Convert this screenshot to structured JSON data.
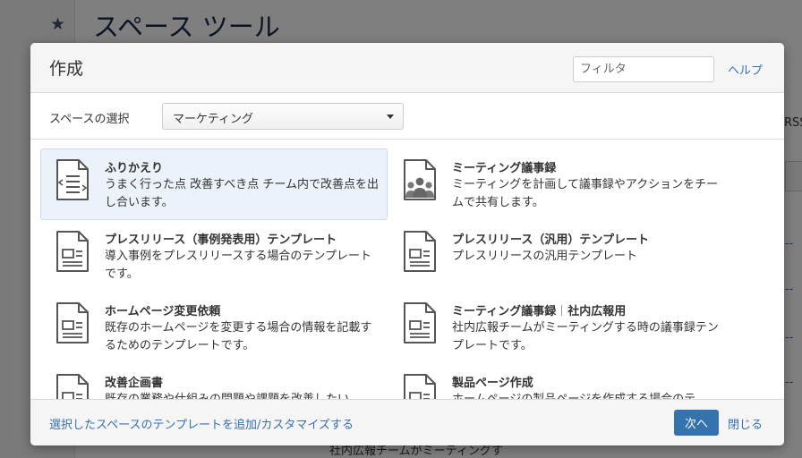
{
  "background": {
    "title": "スペース ツール",
    "rss_text": "RSS",
    "bottom_text": "社内広報チームがミーティングす"
  },
  "dialog": {
    "title": "作成",
    "filter_placeholder": "フィルタ",
    "help_label": "ヘルプ",
    "space_label": "スペースの選択",
    "space_selected": "マーケティング",
    "templates": [
      {
        "name": "ふりかえり",
        "desc": "うまく行った点 改善すべき点 チーム内で改善点を出し合います。",
        "icon": "retrospective-icon",
        "selected": true
      },
      {
        "name": "ミーティング議事録",
        "desc": "ミーティングを計画して議事録やアクションをチームで共有します。",
        "icon": "meeting-notes-icon",
        "selected": false
      },
      {
        "name": "プレスリリース（事例発表用）テンプレート",
        "desc": "導入事例をプレスリリースする場合のテンプレートです。",
        "icon": "page-template-icon",
        "selected": false
      },
      {
        "name": "プレスリリース（汎用）テンプレート",
        "desc": "プレスリリースの汎用テンプレート",
        "icon": "page-template-icon",
        "selected": false
      },
      {
        "name": "ホームページ変更依頼",
        "desc": "既存のホームページを変更する場合の情報を記載するためのテンプレートです。",
        "icon": "page-template-icon",
        "selected": false
      },
      {
        "name_main": "ミーティング議事録",
        "name_sub": "社内広報用",
        "desc": "社内広報チームがミーティングする時の議事録テンプレートです。",
        "icon": "page-template-icon",
        "selected": false
      },
      {
        "name": "改善企画書",
        "desc": "既存の業務や仕組みの問題や課題を改善したい",
        "icon": "page-template-icon",
        "selected": false
      },
      {
        "name": "製品ページ作成",
        "desc": "ホームページの製品ページを作成する場合のテ",
        "icon": "page-template-icon",
        "selected": false
      }
    ],
    "customize_label": "選択したスペースのテンプレートを追加/カスタマイズする",
    "next_label": "次へ",
    "close_label": "閉じる"
  },
  "colors": {
    "link": "#3572b0",
    "primary_button": "#3572b0",
    "selected_bg": "#ebf2f9"
  }
}
